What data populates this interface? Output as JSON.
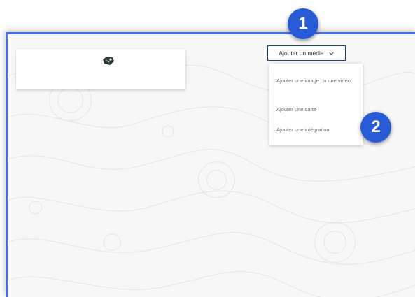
{
  "toolbar": {
    "media_button_label": "Ajouter un média"
  },
  "media_menu": {
    "items": [
      {
        "label": "Ajouter une image ou une vidéo"
      },
      {
        "label": "Ajouter une carte"
      },
      {
        "label": "Ajouter une intégration"
      }
    ]
  },
  "callouts": {
    "step1": "1",
    "step2": "2"
  },
  "icons": {
    "block_icon": "tag-icon",
    "chevron": "chevron-down-icon"
  },
  "colors": {
    "frame_border": "#4a6ee0",
    "badge": "#2a5bd7",
    "button_border": "#1f3e6b"
  }
}
